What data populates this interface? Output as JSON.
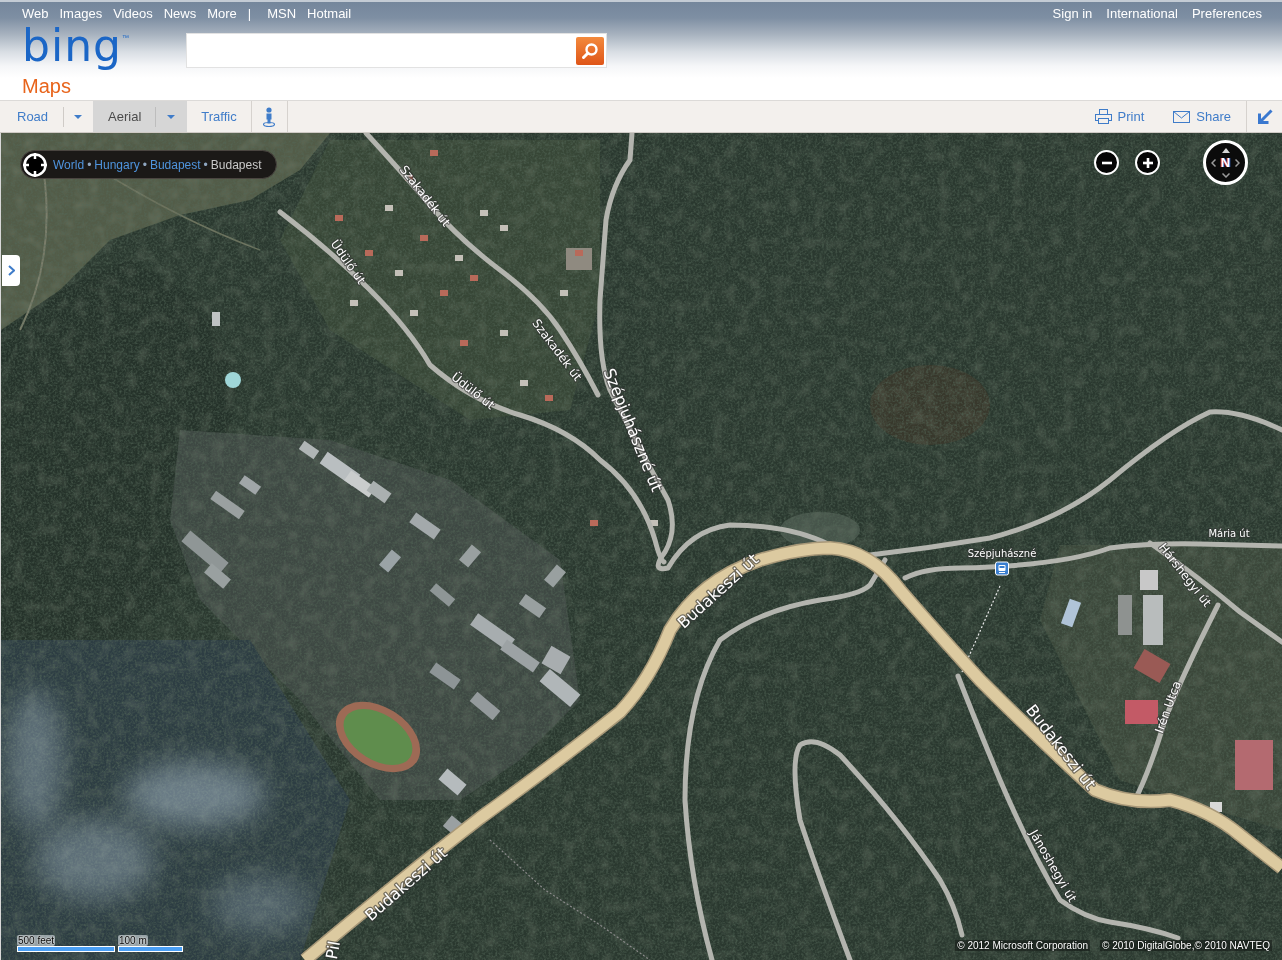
{
  "top_nav": {
    "search_links": [
      "Web",
      "Images",
      "Videos",
      "News",
      "More"
    ],
    "separator": "|",
    "site_links": [
      "MSN",
      "Hotmail"
    ],
    "account_links": [
      "Sign in",
      "International",
      "Preferences"
    ]
  },
  "logo": {
    "brand": "bing",
    "trademark": "™",
    "product": "Maps"
  },
  "toolbar": {
    "tabs": [
      {
        "kind": "view",
        "label": "Road",
        "selected": false
      },
      {
        "kind": "view",
        "label": "Aerial",
        "selected": true
      },
      {
        "kind": "layer",
        "label": "Traffic",
        "selected": false
      }
    ],
    "actions": [
      {
        "kind": "print",
        "label": "Print"
      },
      {
        "kind": "share",
        "label": "Share"
      }
    ]
  },
  "map": {
    "breadcrumb": [
      {
        "label": "World",
        "current": false
      },
      {
        "separator": "•",
        "label": "Hungary",
        "current": false
      },
      {
        "separator": "•",
        "label": "Budapest",
        "current": false
      },
      {
        "separator": "•",
        "label": "Budapest",
        "current": true
      }
    ],
    "compass": {
      "label": "N"
    },
    "road_labels": [
      {
        "text": "Szakadék út",
        "kind": "minor"
      },
      {
        "text": "Üdülő út",
        "kind": "minor"
      },
      {
        "text": "Szakadék út",
        "kind": "minor"
      },
      {
        "text": "Üdülő út",
        "kind": "minor"
      },
      {
        "text": "Szépjuhászné út",
        "kind": "major"
      },
      {
        "text": "Mária út",
        "kind": "small"
      },
      {
        "text": "Szépjuhászné",
        "kind": "stop"
      },
      {
        "text": "Hárshegyi út",
        "kind": "minor"
      },
      {
        "text": "Budakeszi út",
        "kind": "major"
      },
      {
        "text": "Irén Utca",
        "kind": "minor"
      },
      {
        "text": "Budakeszi út",
        "kind": "major"
      },
      {
        "text": "Jánoshegyi út",
        "kind": "minor"
      },
      {
        "text": "Budakeszi út",
        "kind": "major"
      },
      {
        "text": "Pil",
        "kind": "major"
      }
    ],
    "scale": [
      "500 feet",
      "100 m"
    ],
    "copyright": [
      "© 2012 Microsoft Corporation",
      "© 2010 DigitalGlobe,© 2010 NAVTEQ"
    ]
  }
}
